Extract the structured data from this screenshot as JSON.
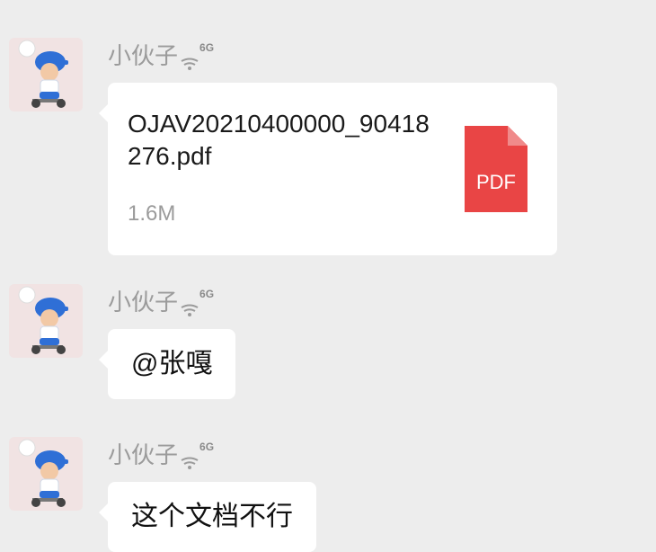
{
  "messages": [
    {
      "sender": "小伙子",
      "network": "6G",
      "file": {
        "name": "OJAV20210400000_90418276.pdf",
        "size": "1.6M",
        "icon_label": "PDF",
        "icon_color": "#e94545"
      }
    },
    {
      "sender": "小伙子",
      "network": "6G",
      "text": "@张嘎"
    },
    {
      "sender": "小伙子",
      "network": "6G",
      "text": "这个文档不行"
    }
  ],
  "icons": {
    "avatar": "avatar-boy-scooter",
    "signal": "wifi-signal-icon",
    "file": "pdf-file-icon"
  }
}
